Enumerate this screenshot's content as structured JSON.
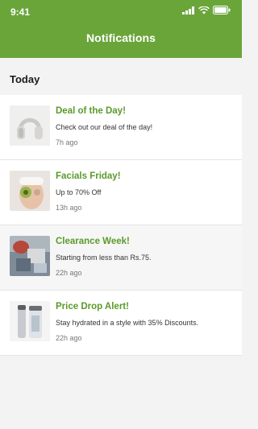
{
  "status_bar": {
    "time": "9:41",
    "icons": [
      "signal-icon",
      "wifi-icon",
      "battery-icon"
    ]
  },
  "header": {
    "title": "Notifications",
    "background": "#6aa53a"
  },
  "section": {
    "title": "Today"
  },
  "notifications": [
    {
      "title": "Deal of the Day!",
      "text": "Check out our deal of the day!",
      "time": "7h ago",
      "thumb": "headphones-image"
    },
    {
      "title": "Facials Friday!",
      "text": "Up to 70% Off",
      "time": "13h ago",
      "thumb": "facial-image"
    },
    {
      "title": "Clearance Week!",
      "text": "Starting from less than Rs.75.",
      "time": "22h ago",
      "thumb": "clothes-image"
    },
    {
      "title": "Price Drop Alert!",
      "text": "Stay hydrated in a style with 35% Discounts.",
      "time": "22h ago",
      "thumb": "bottle-image"
    }
  ]
}
